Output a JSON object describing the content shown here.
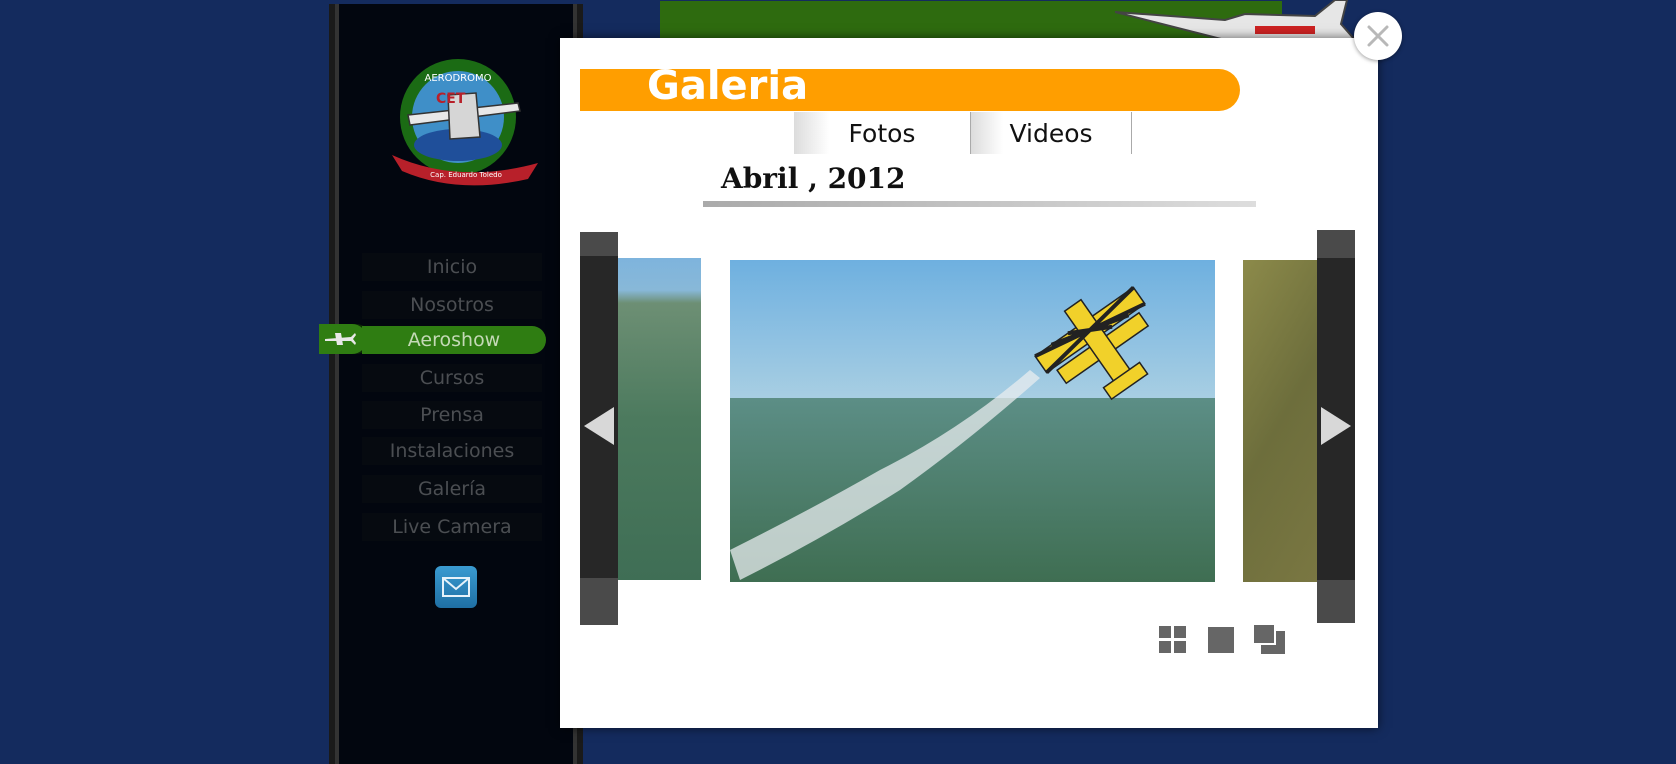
{
  "sidebar": {
    "logo": {
      "ring_top": "AERODROMO",
      "center": "CET",
      "ribbon": "Cap. Eduardo Toledo"
    },
    "nav": [
      {
        "label": "Inicio",
        "active": false
      },
      {
        "label": "Nosotros",
        "active": false
      },
      {
        "label": "Aeroshow",
        "active": true
      },
      {
        "label": "Cursos",
        "active": false
      },
      {
        "label": "Prensa",
        "active": false
      },
      {
        "label": "Instalaciones",
        "active": false
      },
      {
        "label": "Galería",
        "active": false
      },
      {
        "label": "Live Camera",
        "active": false
      }
    ],
    "mail_icon": "envelope-icon"
  },
  "modal": {
    "title": "Galeria",
    "tabs": [
      "Fotos",
      "Videos"
    ],
    "date": "Abril , 2012",
    "prev_icon": "triangle-left-icon",
    "next_icon": "triangle-right-icon",
    "view_modes": [
      "grid-view-icon",
      "single-view-icon",
      "stack-view-icon"
    ],
    "close_icon": "close-icon"
  },
  "colors": {
    "background": "#142b5e",
    "accent": "#ff9e00",
    "nav_active": "#2f7d12"
  }
}
